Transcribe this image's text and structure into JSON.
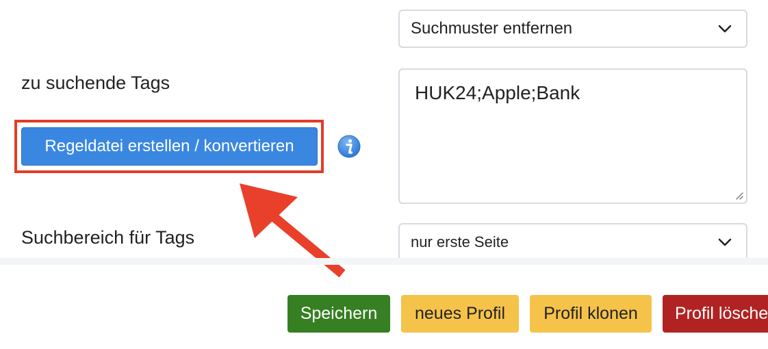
{
  "pattern_select": {
    "value": "Suchmuster entfernen",
    "icon": "chevron-down-icon"
  },
  "tags_section": {
    "label": "zu suchende Tags",
    "textarea_value": "HUK24;Apple;Bank",
    "create_rules_button": "Regeldatei erstellen / konvertieren",
    "info_icon": "info-icon"
  },
  "search_area": {
    "label": "Suchbereich für Tags",
    "value": "nur erste Seite",
    "icon": "chevron-down-icon"
  },
  "annotation": {
    "highlight_color": "#e33c28",
    "arrow_color": "#e8402a"
  },
  "actions": {
    "save": "Speichern",
    "new_profile": "neues Profil",
    "clone_profile": "Profil klonen",
    "delete_profile": "Profil lösche"
  },
  "colors": {
    "primary": "#3a87e1",
    "save": "#367f22",
    "warning": "#f5c34a",
    "danger": "#b12323"
  }
}
